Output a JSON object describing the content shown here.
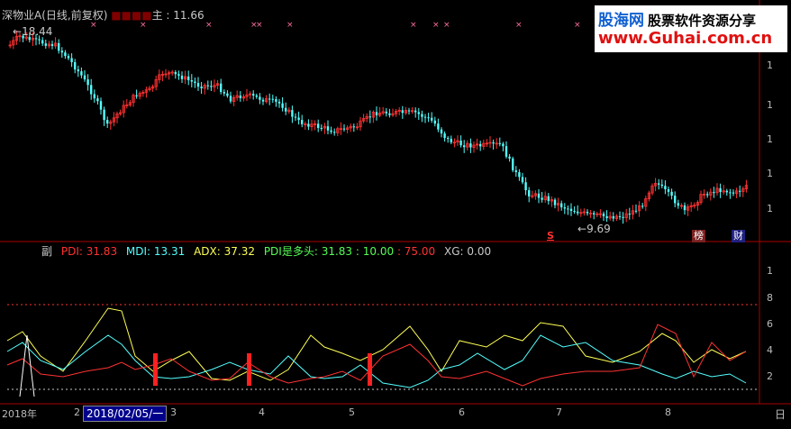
{
  "chart_data": [
    {
      "type": "candlestick",
      "header": {
        "name_prefix": "深物业A(日线,前复权)",
        "field_label": "主",
        "field_value": "11.66"
      },
      "high_label": "18.44",
      "low_label": "9.69",
      "markers": {
        "s_label": "S",
        "rank_label": "榜",
        "fin_label": "财"
      },
      "y_axis_ticks": [
        "1",
        "1",
        "1",
        "1",
        "1",
        "1"
      ],
      "colors": {
        "up": "#ff3232",
        "down": "#54ffff",
        "text": "#c8c8c8"
      }
    },
    {
      "type": "line",
      "indicator_label": "副",
      "series": [
        {
          "name": "PDI",
          "value": "31.83",
          "color": "#ff3232"
        },
        {
          "name": "MDI",
          "value": "13.31",
          "color": "#54ffff"
        },
        {
          "name": "ADX",
          "value": "37.32",
          "color": "#ffff54"
        },
        {
          "name": "PDI是多头",
          "value": "31.83",
          "color": "#54ff54"
        },
        {
          "name": "",
          "value": "10.00",
          "color": "#54ff54"
        },
        {
          "name": "",
          "value": "75.00",
          "color": "#ff3232"
        },
        {
          "name": "XG",
          "value": "0.00",
          "color": "#ffffff"
        }
      ],
      "y_axis_ticks": [
        "1",
        "8",
        "6",
        "4",
        "2"
      ]
    }
  ],
  "time_axis": {
    "year_label": "2018年",
    "date_box": "2018/02/05/一",
    "months": [
      "2",
      "3",
      "4",
      "5",
      "6",
      "7",
      "8",
      "日"
    ]
  },
  "watermark": {
    "site_cn": "股海网",
    "slogan": "股票软件资源分享",
    "url": "www.Guhai.com.cn"
  }
}
